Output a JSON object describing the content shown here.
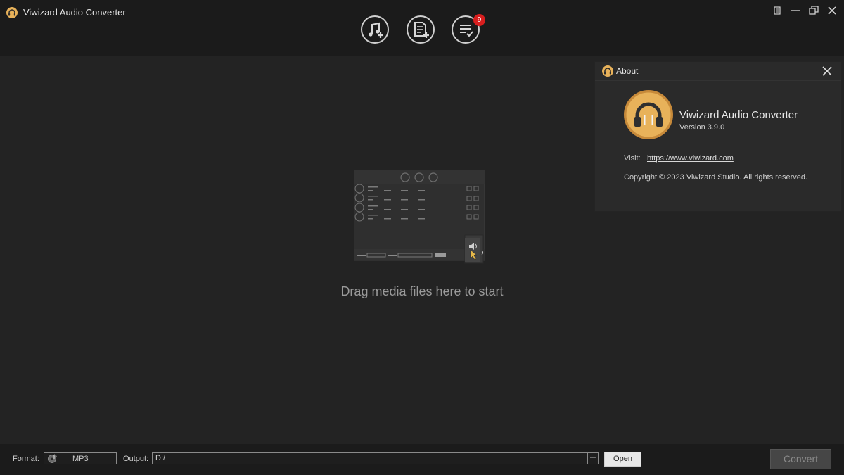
{
  "window": {
    "title": "Viwizard Audio Converter",
    "brand_color": "#e8b25a"
  },
  "toolbar": {
    "buttons": [
      {
        "name": "add-music",
        "icon": "music-add-icon"
      },
      {
        "name": "add-file",
        "icon": "file-add-icon"
      },
      {
        "name": "converted-list",
        "icon": "list-check-icon",
        "badge": "9"
      }
    ]
  },
  "window_controls": [
    "menu-icon",
    "minimize-icon",
    "restore-icon",
    "close-icon"
  ],
  "drop_area": {
    "hint": "Drag media files here to start"
  },
  "about": {
    "title": "About",
    "product_name": "Viwizard Audio Converter",
    "version": "Version 3.9.0",
    "visit_label": "Visit:",
    "visit_url": "https://www.viwizard.com",
    "copyright": "Copyright © 2023 Viwizard Studio. All rights reserved."
  },
  "bottom": {
    "format_label": "Format:",
    "format_value": "MP3",
    "output_label": "Output:",
    "output_value": "D:/",
    "browse_label": "···",
    "open_label": "Open",
    "convert_label": "Convert"
  }
}
